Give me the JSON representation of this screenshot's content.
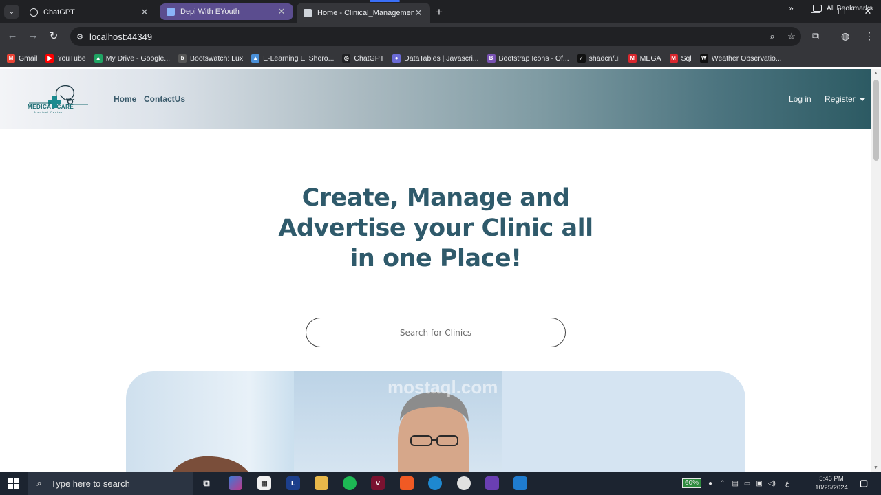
{
  "browser": {
    "tabs": [
      {
        "title": "ChatGPT"
      },
      {
        "title": "Depi With EYouth"
      },
      {
        "title": "Home - Clinical_Management_S"
      }
    ],
    "url": "localhost:44349",
    "bookmarks": [
      {
        "label": "Gmail",
        "color": "#ea4335",
        "glyph": "M"
      },
      {
        "label": "YouTube",
        "color": "#ff0000",
        "glyph": "▶"
      },
      {
        "label": "My Drive - Google...",
        "color": "#1fa463",
        "glyph": "▲"
      },
      {
        "label": "Bootswatch: Lux",
        "color": "#555555",
        "glyph": "b"
      },
      {
        "label": "E-Learning El Shoro...",
        "color": "#4a90d9",
        "glyph": "▲"
      },
      {
        "label": "ChatGPT",
        "color": "#202124",
        "glyph": "◎"
      },
      {
        "label": "DataTables | Javascri...",
        "color": "#6b6bd6",
        "glyph": "●"
      },
      {
        "label": "Bootstrap Icons - Of...",
        "color": "#7952b3",
        "glyph": "B"
      },
      {
        "label": "shadcn/ui",
        "color": "#111111",
        "glyph": "⁄"
      },
      {
        "label": "MEGA",
        "color": "#d9272e",
        "glyph": "M"
      },
      {
        "label": "Sql",
        "color": "#d9272e",
        "glyph": "M"
      },
      {
        "label": "Weather Observatio...",
        "color": "#111111",
        "glyph": "W"
      }
    ],
    "bookmarks_more": "»",
    "all_bookmarks": "All Bookmarks"
  },
  "site": {
    "logo_text": "MEDICAL CARE",
    "logo_sub": "Medical Center",
    "nav": {
      "home": "Home",
      "contact": "ContactUs",
      "login": "Log in",
      "register": "Register"
    },
    "hero_title": "Create, Manage and Advertise your Clinic all in one Place!",
    "search_placeholder": "Search for Clinics"
  },
  "watermark": "mostaql.com",
  "taskbar": {
    "search_placeholder": "Type here to search",
    "battery": "60%",
    "lang": "ع",
    "time": "5:46 PM",
    "date": "10/25/2024"
  },
  "colors": {
    "accent": "#2f5a6b",
    "nav_gradient_end": "#2c5a63"
  }
}
